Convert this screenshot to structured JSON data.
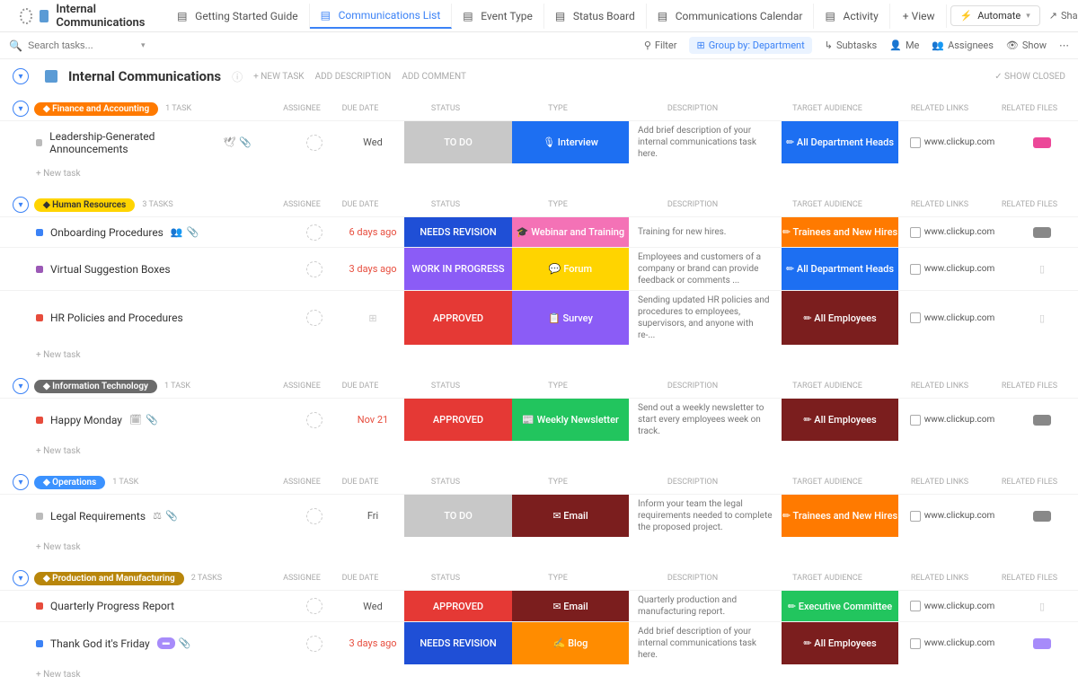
{
  "header": {
    "title": "Internal Communications",
    "tabs": [
      {
        "label": "Getting Started Guide"
      },
      {
        "label": "Communications List"
      },
      {
        "label": "Event Type"
      },
      {
        "label": "Status Board"
      },
      {
        "label": "Communications Calendar"
      },
      {
        "label": "Activity"
      }
    ],
    "add_view": "+ View",
    "automate": "Automate",
    "share": "Share"
  },
  "toolbar": {
    "search_placeholder": "Search tasks...",
    "filter": "Filter",
    "group_by": "Group by: Department",
    "subtasks": "Subtasks",
    "me": "Me",
    "assignees": "Assignees",
    "show": "Show"
  },
  "list_header": {
    "name": "Internal Communications",
    "new_task": "+ NEW TASK",
    "add_desc": "ADD DESCRIPTION",
    "add_comment": "ADD COMMENT",
    "show_closed": "SHOW CLOSED"
  },
  "columns": {
    "assignee": "ASSIGNEE",
    "due": "DUE DATE",
    "status": "STATUS",
    "type": "TYPE",
    "description": "DESCRIPTION",
    "audience": "TARGET AUDIENCE",
    "links": "RELATED LINKS",
    "files": "RELATED FILES"
  },
  "new_task_inline": "+ New task",
  "groups": [
    {
      "name": "Finance and Accounting",
      "pill": "orange",
      "count": "1 TASK",
      "rows": [
        {
          "sq": "grey",
          "name": "Leadership-Generated Announcements",
          "extras": [
            "🕊",
            "📎"
          ],
          "due": "Wed",
          "status": "TO DO",
          "status_cls": "st-todo",
          "type": "🎙 Interview",
          "type_cls": "ty-interview",
          "desc": "Add brief description of your internal communications task here.",
          "aud": "✏ All Department Heads",
          "aud_cls": "au-heads",
          "link": "www.clickup.com",
          "file": "pink"
        }
      ]
    },
    {
      "name": "Human Resources",
      "pill": "yellow",
      "count": "3 TASKS",
      "rows": [
        {
          "sq": "blue",
          "name": "Onboarding Procedures",
          "extras": [
            "👥",
            "📎"
          ],
          "due": "6 days ago",
          "overdue": true,
          "status": "NEEDS REVISION",
          "status_cls": "st-needs",
          "type": "🎓 Webinar and Training",
          "type_cls": "ty-webinar",
          "desc": "Training for new hires.",
          "aud": "✏ Trainees and New Hires",
          "aud_cls": "au-trainees",
          "link": "www.clickup.com",
          "file": "grey"
        },
        {
          "sq": "purple",
          "name": "Virtual Suggestion Boxes",
          "extras": [],
          "due": "3 days ago",
          "overdue": true,
          "status": "WORK IN PROGRESS",
          "status_cls": "st-wip",
          "type": "💬 Forum",
          "type_cls": "ty-forum",
          "desc": "Employees and customers of a company or brand can provide feedback or comments ...",
          "aud": "✏ All Department Heads",
          "aud_cls": "au-heads",
          "link": "www.clickup.com",
          "file": ""
        },
        {
          "sq": "red",
          "name": "HR Policies and Procedures",
          "extras": [],
          "due": "",
          "status": "APPROVED",
          "status_cls": "st-appr",
          "type": "📋 Survey",
          "type_cls": "ty-survey",
          "desc": "Sending updated HR policies and procedures to employees, supervisors, and anyone with re-...",
          "aud": "✏ All Employees",
          "aud_cls": "au-all",
          "link": "www.clickup.com",
          "file": ""
        }
      ]
    },
    {
      "name": "Information Technology",
      "pill": "grey",
      "count": "1 TASK",
      "rows": [
        {
          "sq": "red",
          "name": "Happy Monday",
          "extras": [
            "🗓",
            "📎"
          ],
          "due": "Nov 21",
          "overdue": true,
          "status": "APPROVED",
          "status_cls": "st-appr",
          "type": "📰 Weekly Newsletter",
          "type_cls": "ty-news",
          "desc": "Send out a weekly newsletter to start every employees week on track.",
          "aud": "✏ All Employees",
          "aud_cls": "au-all",
          "link": "www.clickup.com",
          "file": "grey"
        }
      ]
    },
    {
      "name": "Operations",
      "pill": "blue",
      "count": "1 TASK",
      "rows": [
        {
          "sq": "grey",
          "name": "Legal Requirements",
          "extras": [
            "⚖",
            "📎"
          ],
          "due": "Fri",
          "status": "TO DO",
          "status_cls": "st-todo",
          "type": "✉ Email",
          "type_cls": "ty-email",
          "desc": "Inform your team the legal requirements needed to complete the proposed project.",
          "aud": "✏ Trainees and New Hires",
          "aud_cls": "au-trainees",
          "link": "www.clickup.com",
          "file": "grey"
        }
      ]
    },
    {
      "name": "Production and Manufacturing",
      "pill": "brown",
      "count": "2 TASKS",
      "rows": [
        {
          "sq": "red",
          "name": "Quarterly Progress Report",
          "extras": [],
          "due": "Wed",
          "status": "APPROVED",
          "status_cls": "st-appr",
          "type": "✉ Email",
          "type_cls": "ty-email",
          "desc": "Quarterly production and manufacturing report.",
          "aud": "✏ Executive Committee",
          "aud_cls": "au-exec",
          "link": "www.clickup.com",
          "file": ""
        },
        {
          "sq": "blue",
          "name": "Thank God it's Friday",
          "extras": [
            "chip",
            "📎"
          ],
          "due": "3 days ago",
          "overdue": true,
          "status": "NEEDS REVISION",
          "status_cls": "st-needs",
          "type": "✍ Blog",
          "type_cls": "ty-blog",
          "desc": "Add brief description of your internal communications task here.",
          "aud": "✏ All Employees",
          "aud_cls": "au-all",
          "link": "www.clickup.com",
          "file": "purple"
        }
      ]
    }
  ]
}
